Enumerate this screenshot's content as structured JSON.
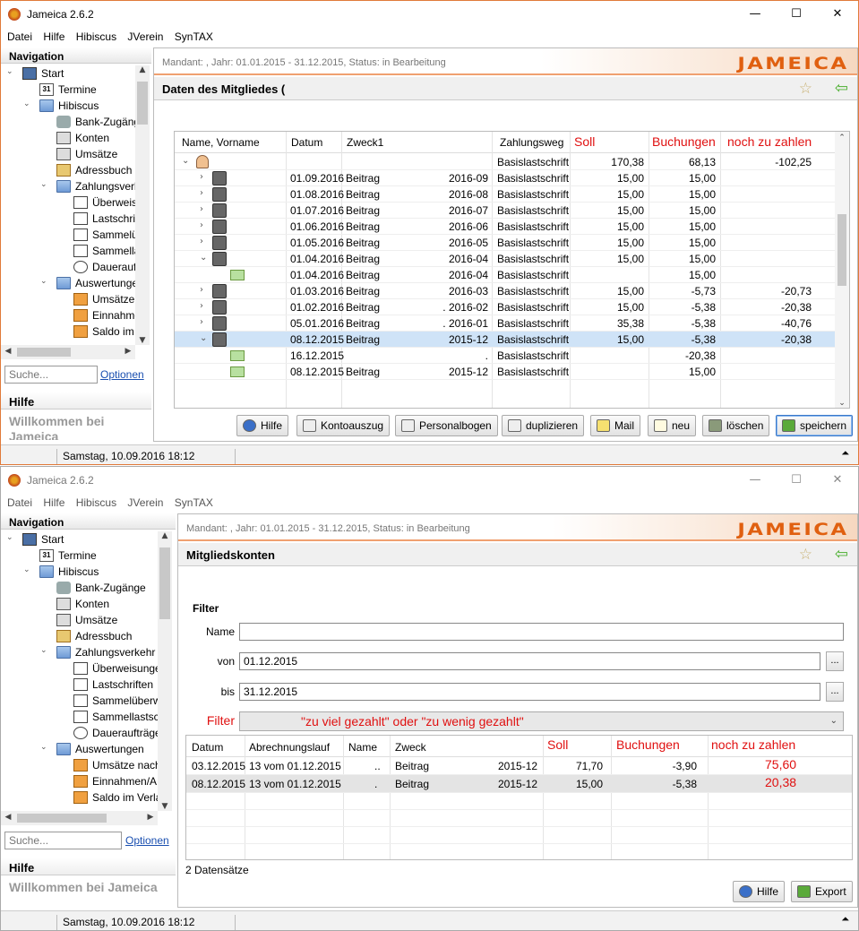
{
  "app_title": "Jameica 2.6.2",
  "menu": [
    "Datei",
    "Hilfe",
    "Hibiscus",
    "JVerein",
    "SynTAX"
  ],
  "window_controls": {
    "min": "—",
    "max": "☐",
    "close": "✕"
  },
  "sidebar": {
    "nav_title": "Navigation",
    "tree": [
      {
        "label": "Start",
        "icon": "computer-icon",
        "level": 0,
        "expander": "⌄"
      },
      {
        "label": "Termine",
        "icon": "calendar-icon",
        "level": 1,
        "expander": ""
      },
      {
        "label": "Hibiscus",
        "icon": "folder-icon",
        "level": 1,
        "expander": "⌄"
      },
      {
        "label": "Bank-Zugänge",
        "icon": "tools-icon",
        "level": 2,
        "expander": ""
      },
      {
        "label": "Konten",
        "icon": "safe-icon",
        "level": 2,
        "expander": ""
      },
      {
        "label": "Umsätze",
        "icon": "list-icon",
        "level": 2,
        "expander": ""
      },
      {
        "label": "Adressbuch",
        "icon": "addressbook-icon",
        "level": 2,
        "expander": ""
      },
      {
        "label": "Zahlungsverkehr",
        "icon": "folder-icon",
        "level": 2,
        "expander": "⌄"
      },
      {
        "label": "Überweisungen",
        "icon": "transfer-icon",
        "level": 3,
        "expander": ""
      },
      {
        "label": "Lastschriften",
        "icon": "debit-icon",
        "level": 3,
        "expander": ""
      },
      {
        "label": "Sammelüberweisungen",
        "icon": "batch-transfer-icon",
        "level": 3,
        "expander": ""
      },
      {
        "label": "Sammellastschriften",
        "icon": "batch-debit-icon",
        "level": 3,
        "expander": ""
      },
      {
        "label": "Daueraufträge",
        "icon": "clock-icon",
        "level": 3,
        "expander": ""
      },
      {
        "label": "Auswertungen",
        "icon": "folder-icon",
        "level": 2,
        "expander": "⌄"
      },
      {
        "label": "Umsätze nach",
        "icon": "chart-icon",
        "level": 3,
        "expander": ""
      },
      {
        "label": "Einnahmen/A",
        "icon": "chart-icon",
        "level": 3,
        "expander": ""
      },
      {
        "label": "Saldo im Verla",
        "icon": "chart-icon",
        "level": 3,
        "expander": ""
      }
    ],
    "search_placeholder": "Suche...",
    "options_link": "Optionen",
    "help_title": "Hilfe",
    "help_body": "Willkommen bei Jameica"
  },
  "status_text": "Samstag, 10.09.2016 18:12",
  "status_arrow": "⏶",
  "window1": {
    "header_text": "Mandant:                               , Jahr: 01.01.2015 - 31.12.2015, Status: in Bearbeitung",
    "logo": "JAMEICA",
    "page_title": "Daten des Mitgliedes (",
    "star": "☆",
    "back": "⇦",
    "columns": [
      "Name, Vorname",
      "Datum",
      "Zweck1",
      "Zahlungsweg",
      "Soll",
      "Buchungen",
      "noch zu zahlen"
    ],
    "rows": [
      {
        "expander": "⌄",
        "icon": "person",
        "datum": "",
        "zweck": "",
        "period": "",
        "weg": "Basislastschrift",
        "soll": "170,38",
        "buchungen": "68,13",
        "noch": "-102,25",
        "sel": false,
        "indent": 0
      },
      {
        "expander": "›",
        "icon": "calc",
        "datum": "01.09.2016",
        "zweck": "Beitrag",
        "period": "2016-09",
        "weg": "Basislastschrift",
        "soll": "15,00",
        "buchungen": "15,00",
        "noch": "",
        "sel": false,
        "indent": 1
      },
      {
        "expander": "›",
        "icon": "calc",
        "datum": "01.08.2016",
        "zweck": "Beitrag",
        "period": "2016-08",
        "weg": "Basislastschrift",
        "soll": "15,00",
        "buchungen": "15,00",
        "noch": "",
        "sel": false,
        "indent": 1
      },
      {
        "expander": "›",
        "icon": "calc",
        "datum": "01.07.2016",
        "zweck": "Beitrag",
        "period": "2016-07",
        "weg": "Basislastschrift",
        "soll": "15,00",
        "buchungen": "15,00",
        "noch": "",
        "sel": false,
        "indent": 1
      },
      {
        "expander": "›",
        "icon": "calc",
        "datum": "01.06.2016",
        "zweck": "Beitrag",
        "period": "2016-06",
        "weg": "Basislastschrift",
        "soll": "15,00",
        "buchungen": "15,00",
        "noch": "",
        "sel": false,
        "indent": 1
      },
      {
        "expander": "›",
        "icon": "calc",
        "datum": "01.05.2016",
        "zweck": "Beitrag",
        "period": "2016-05",
        "weg": "Basislastschrift",
        "soll": "15,00",
        "buchungen": "15,00",
        "noch": "",
        "sel": false,
        "indent": 1
      },
      {
        "expander": "⌄",
        "icon": "calc",
        "datum": "01.04.2016",
        "zweck": "Beitrag",
        "period": "2016-04",
        "weg": "Basislastschrift",
        "soll": "15,00",
        "buchungen": "15,00",
        "noch": "",
        "sel": false,
        "indent": 1
      },
      {
        "expander": "",
        "icon": "money",
        "datum": "01.04.2016",
        "zweck": "Beitrag",
        "period": "2016-04",
        "weg": "Basislastschrift",
        "soll": "",
        "buchungen": "15,00",
        "noch": "",
        "sel": false,
        "indent": 2
      },
      {
        "expander": "›",
        "icon": "calc",
        "datum": "01.03.2016",
        "zweck": "Beitrag",
        "period": "2016-03",
        "weg": "Basislastschrift",
        "soll": "15,00",
        "buchungen": "-5,73",
        "noch": "-20,73",
        "sel": false,
        "indent": 1
      },
      {
        "expander": "›",
        "icon": "calc",
        "datum": "01.02.2016",
        "zweck": "Beitrag",
        "period": ". 2016-02",
        "weg": "Basislastschrift",
        "soll": "15,00",
        "buchungen": "-5,38",
        "noch": "-20,38",
        "sel": false,
        "indent": 1
      },
      {
        "expander": "›",
        "icon": "calc",
        "datum": "05.01.2016",
        "zweck": "Beitrag",
        "period": ". 2016-01",
        "weg": "Basislastschrift",
        "soll": "35,38",
        "buchungen": "-5,38",
        "noch": "-40,76",
        "sel": false,
        "indent": 1
      },
      {
        "expander": "⌄",
        "icon": "calc",
        "datum": "08.12.2015",
        "zweck": "Beitrag",
        "period": "2015-12",
        "weg": "Basislastschrift",
        "soll": "15,00",
        "buchungen": "-5,38",
        "noch": "-20,38",
        "sel": true,
        "indent": 1
      },
      {
        "expander": "",
        "icon": "money",
        "datum": "16.12.2015",
        "zweck": "",
        "period": ".",
        "weg": "Basislastschrift",
        "soll": "",
        "buchungen": "-20,38",
        "noch": "",
        "sel": false,
        "indent": 2
      },
      {
        "expander": "",
        "icon": "money",
        "datum": "08.12.2015",
        "zweck": "Beitrag",
        "period": "2015-12",
        "weg": "Basislastschrift",
        "soll": "",
        "buchungen": "15,00",
        "noch": "",
        "sel": false,
        "indent": 2
      }
    ],
    "buttons": [
      {
        "label": "Hilfe",
        "icon": "help-icon"
      },
      {
        "label": "Kontoauszug",
        "icon": "statement-icon"
      },
      {
        "label": "Personalbogen",
        "icon": "document-icon"
      },
      {
        "label": "duplizieren",
        "icon": "duplicate-icon"
      },
      {
        "label": "Mail",
        "icon": "mail-icon"
      },
      {
        "label": "neu",
        "icon": "new-icon"
      },
      {
        "label": "löschen",
        "icon": "delete-icon"
      },
      {
        "label": "speichern",
        "icon": "save-icon"
      }
    ]
  },
  "window2": {
    "header_text": "Mandant:                               , Jahr: 01.01.2015 - 31.12.2015, Status: in Bearbeitung",
    "logo": "JAMEICA",
    "page_title": "Mitgliedskonten",
    "star": "☆",
    "back": "⇦",
    "filter": {
      "title": "Filter",
      "name_label": "Name",
      "name_value": "",
      "von_label": "von",
      "von_value": "01.12.2015",
      "bis_label": "bis",
      "bis_value": "31.12.2015",
      "date_button": "...",
      "filter_label": "Filter",
      "filter_value": "\"zu viel gezahlt\" oder \"zu wenig gezahlt\"",
      "dropdown_arrow": "⌄"
    },
    "columns": [
      "Datum",
      "Abrechnungslauf",
      "Name",
      "Zweck",
      "Soll",
      "Buchungen",
      "noch zu zahlen"
    ],
    "rows": [
      {
        "datum": "03.12.2015",
        "lauf": "13 vom 01.12.2015",
        "name": "..",
        "zweck": "Beitrag",
        "period": "2015-12",
        "soll": "71,70",
        "buchungen": "-3,90",
        "noch": "75,60",
        "sel": false
      },
      {
        "datum": "08.12.2015",
        "lauf": "13 vom 01.12.2015",
        "name": ".",
        "zweck": "Beitrag",
        "period": "2015-12",
        "soll": "15,00",
        "buchungen": "-5,38",
        "noch": "20,38",
        "sel": true
      }
    ],
    "count": "2 Datensätze",
    "buttons": [
      {
        "label": "Hilfe",
        "icon": "help-icon"
      },
      {
        "label": "Export",
        "icon": "export-icon"
      }
    ]
  },
  "colors": {
    "accent": "#e06010",
    "red": "#e01010",
    "selected": "#cfe3f7",
    "link": "#1a4fb0"
  }
}
